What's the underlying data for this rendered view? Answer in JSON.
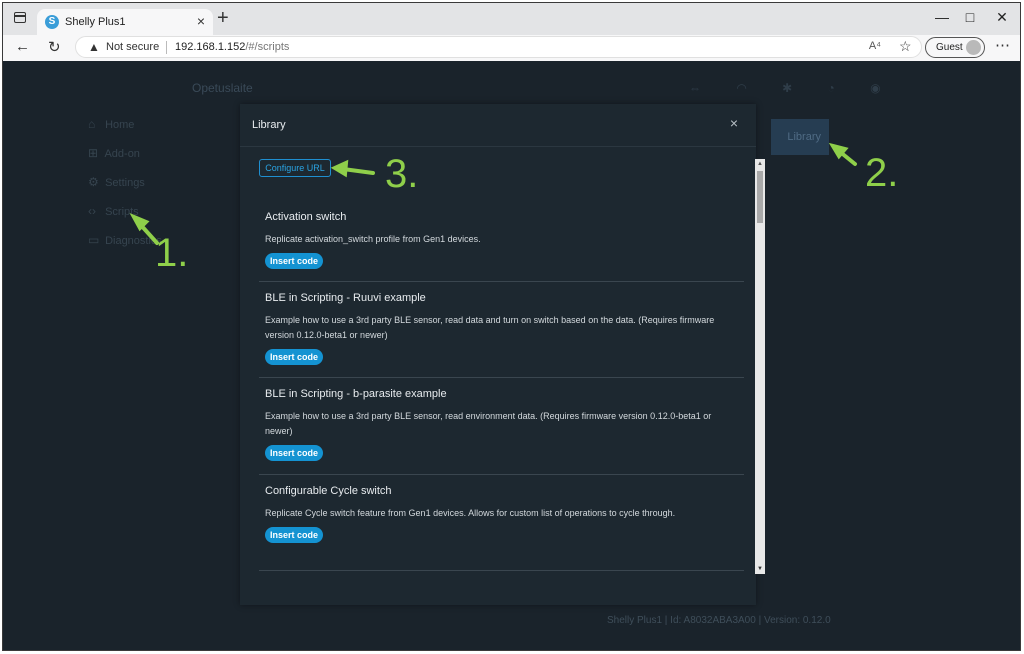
{
  "browser": {
    "tab_title": "Shelly Plus1",
    "tab_favicon": "S",
    "not_secure": "Not secure",
    "url_host": "192.168.1.152",
    "url_path": "/#/scripts",
    "read_aloud": "A⁴",
    "profile": "Guest",
    "icons": [
      "sidebar-toggle-icon",
      "close-icon",
      "plus-icon",
      "minimize-icon",
      "maximize-icon",
      "window-close-icon",
      "back-icon",
      "refresh-icon",
      "warning-icon",
      "favorites-icon",
      "more-icon"
    ]
  },
  "page": {
    "device_name": "Opetuslaite",
    "sidebar": [
      {
        "icon": "⌂",
        "label": "Home"
      },
      {
        "icon": "⊞",
        "label": "Add-on"
      },
      {
        "icon": "⚙",
        "label": "Settings"
      },
      {
        "icon": "‹›",
        "label": "Scripts"
      },
      {
        "icon": "▭",
        "label": "Diagnostics"
      }
    ],
    "library_button": "Library",
    "footer": "Shelly Plus1 | Id: A8032ABA3A00 | Version: 0.12.0"
  },
  "modal": {
    "title": "Library",
    "close": "×",
    "configure_url": "Configure URL",
    "insert_label": "Insert code",
    "entries": [
      {
        "title": "Activation switch",
        "description": "Replicate activation_switch profile from Gen1 devices."
      },
      {
        "title": "BLE in Scripting - Ruuvi example",
        "description": "Example how to use a 3rd party BLE sensor, read data and turn on switch based on the data. (Requires firmware version 0.12.0-beta1 or newer)"
      },
      {
        "title": "BLE in Scripting - b-parasite example",
        "description": "Example how to use a 3rd party BLE sensor, read environment data. (Requires firmware version 0.12.0-beta1 or newer)"
      },
      {
        "title": "Configurable Cycle switch",
        "description": "Replicate Cycle switch feature from Gen1 devices. Allows for custom list of operations to cycle through."
      }
    ]
  },
  "annotations": {
    "a1": "1.",
    "a2": "2.",
    "a3": "3.",
    "color": "#8fcf4a"
  }
}
